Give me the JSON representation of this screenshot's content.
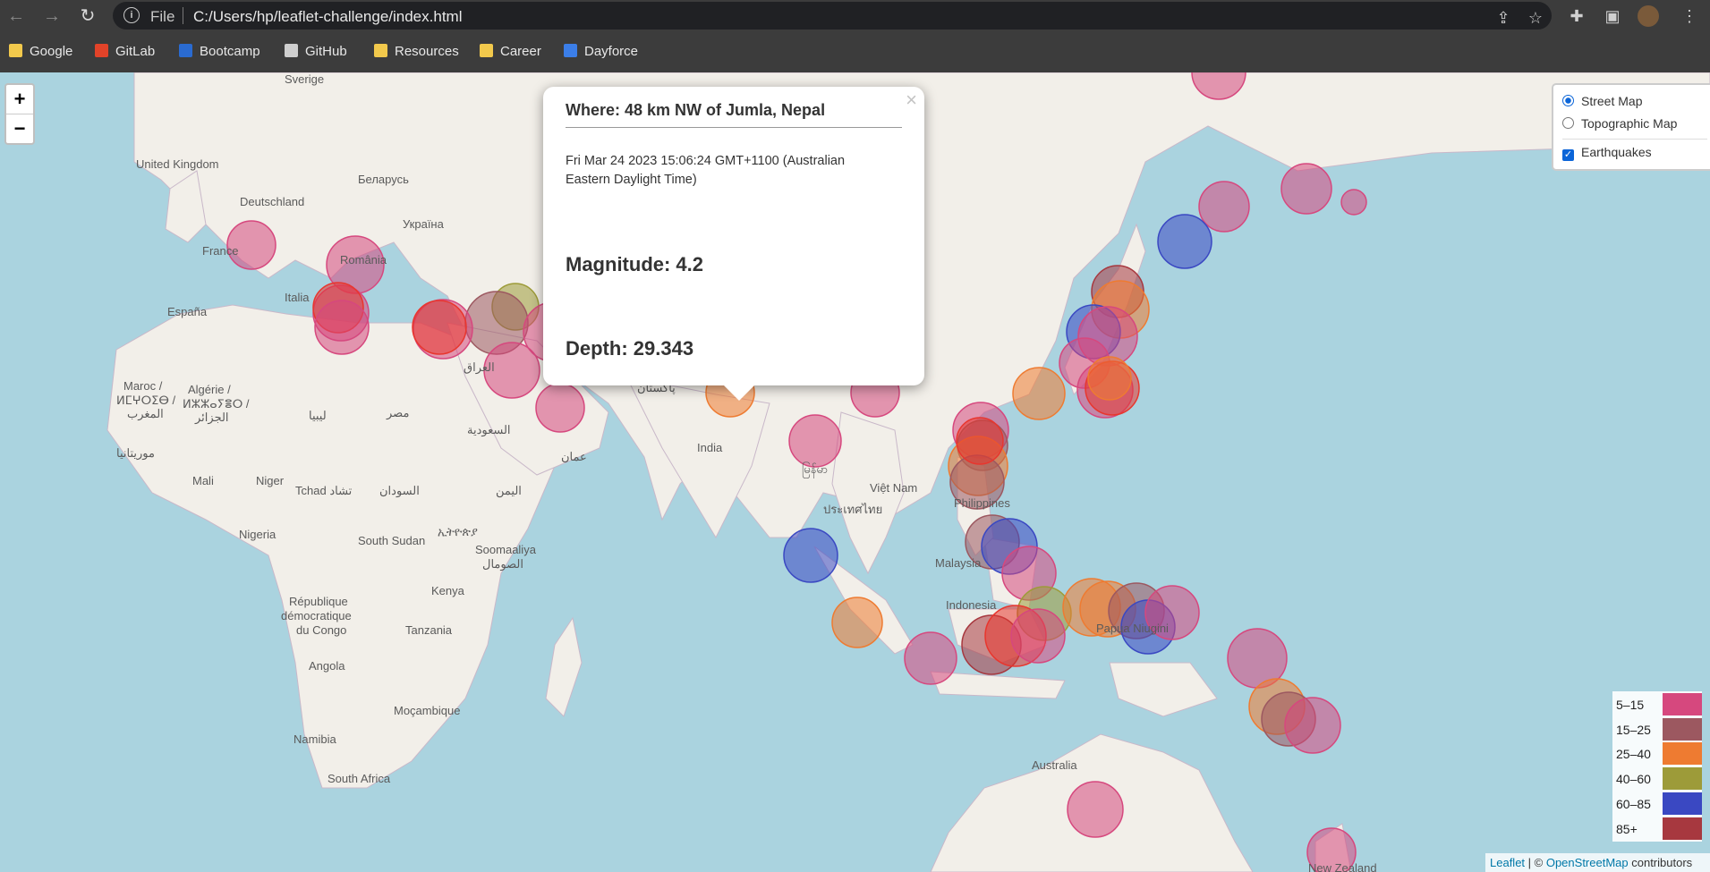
{
  "browser": {
    "file_label": "File",
    "url": "C:/Users/hp/leaflet-challenge/index.html"
  },
  "bookmarks": [
    {
      "label": "Google",
      "icon": "folder-icon",
      "color": "#f2c94c"
    },
    {
      "label": "GitLab",
      "icon": "gitlab-icon",
      "color": "#e24329"
    },
    {
      "label": "Bootcamp",
      "icon": "bootcamp-icon",
      "color": "#2a6bd1"
    },
    {
      "label": "GitHub",
      "icon": "github-icon",
      "color": "#cfcfcf"
    },
    {
      "label": "Resources",
      "icon": "folder-icon",
      "color": "#f2c94c"
    },
    {
      "label": "Career",
      "icon": "folder-icon",
      "color": "#f2c94c"
    },
    {
      "label": "Dayforce",
      "icon": "dayforce-icon",
      "color": "#3b7ee8"
    }
  ],
  "map": {
    "zoom_in": "+",
    "zoom_out": "−",
    "labels": {
      "sverige": "Sverige",
      "uk": "United Kingdom",
      "deutschland": "Deutschland",
      "belarus": "Беларусь",
      "ukraina": "Україна",
      "france": "France",
      "romania": "România",
      "italia": "Italia",
      "espana": "España",
      "maroc": "Maroc /",
      "maroc2": "ⵍⵎⵖⵔⵉⴱ /",
      "maroc3": "المغرب",
      "algerie": "Algérie /",
      "algerie2": "ⵍⵣⵣⴰⵢⴻⵔ /",
      "algerie3": "الجزائر",
      "libya": "ليبيا",
      "egypt": "مصر",
      "iraq": "العراق",
      "saudi": "السعودية",
      "oman": "عمان",
      "yemen": "اليمن",
      "pakistan": "پاکستان",
      "mauritania": "موريتانيا",
      "mali": "Mali",
      "niger": "Niger",
      "tchad": "Tchad تشاد",
      "sudan": "السودان",
      "nigeria": "Nigeria",
      "south_sudan": "South Sudan",
      "ethiopia": "ኢትዮጵያ",
      "somalia": "Soomaaliya",
      "somalia2": "الصومال",
      "kenya": "Kenya",
      "drc": "République",
      "drc2": "démocratique",
      "drc3": "du Congo",
      "tanzania": "Tanzania",
      "angola": "Angola",
      "mozambique": "Moçambique",
      "namibia": "Namibia",
      "south_africa": "South Africa",
      "india": "India",
      "myanmar": "မြန်မာ",
      "vietnam": "Việt Nam",
      "thailand": "ประเทศไทย",
      "philippines": "Philippines",
      "malaysia": "Malaysia",
      "indonesia": "Indonesia",
      "png": "Papua Niugini",
      "australia": "Australia",
      "nz": "New Zealand"
    }
  },
  "layer_control": {
    "base_layers": [
      {
        "label": "Street Map",
        "selected": true
      },
      {
        "label": "Topographic Map",
        "selected": false
      }
    ],
    "overlays": [
      {
        "label": "Earthquakes",
        "checked": true
      }
    ]
  },
  "popup": {
    "where": "Where: 48 km NW of Jumla, Nepal",
    "time": "Fri Mar 24 2023 15:06:24 GMT+1100 (Australian Eastern Daylight Time)",
    "magnitude": "Magnitude: 4.2",
    "depth": "Depth: 29.343",
    "close": "×"
  },
  "legend": [
    {
      "label": "5–15",
      "color": "#d6487e"
    },
    {
      "label": "15–25",
      "color": "#9c5860"
    },
    {
      "label": "25–40",
      "color": "#ee7b31"
    },
    {
      "label": "40–60",
      "color": "#9d9b39"
    },
    {
      "label": "60–85",
      "color": "#3a48c2"
    },
    {
      "label": "85+",
      "color": "#a7383f"
    }
  ],
  "attribution": {
    "leaflet": "Leaflet",
    "sep": " | © ",
    "osm": "OpenStreetMap",
    "rest": " contributors"
  }
}
